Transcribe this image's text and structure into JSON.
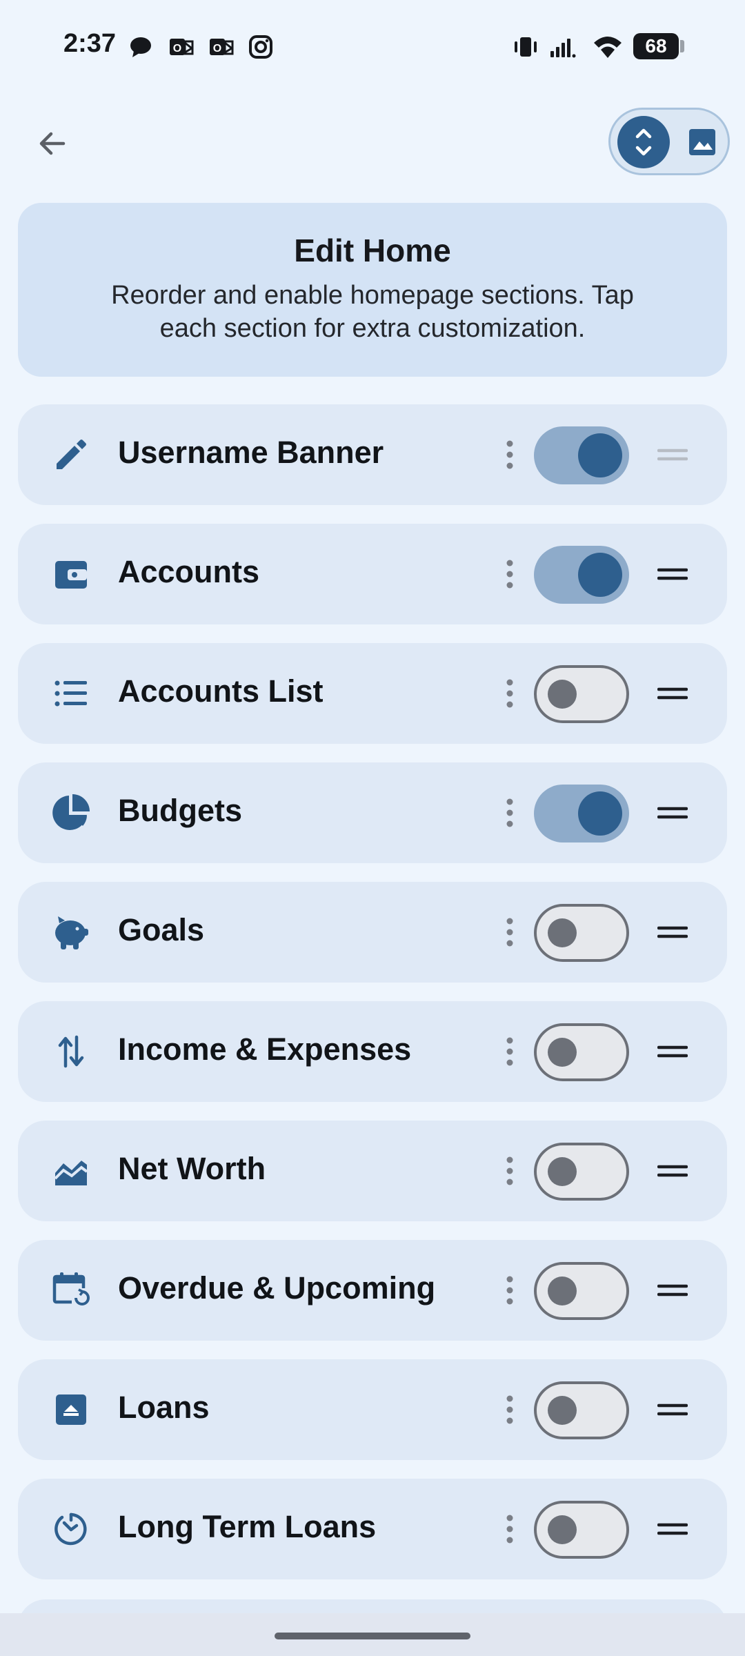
{
  "status_bar": {
    "time": "2:37",
    "battery": "68",
    "left_icons": [
      "chat-bubble-icon",
      "outlook-icon",
      "outlook-icon",
      "instagram-icon"
    ],
    "right_icons": [
      "vibrate-icon",
      "signal-icon",
      "wifi-icon",
      "battery-icon"
    ]
  },
  "top_bar": {
    "back_icon": "arrow-back-icon",
    "toggle": {
      "reorder_icon": "unfold-icon",
      "image_icon": "image-icon",
      "selected": "reorder"
    }
  },
  "header": {
    "title": "Edit Home",
    "description": "Reorder and enable homepage sections. Tap each section for extra customization."
  },
  "sections": [
    {
      "label": "Username Banner",
      "icon": "pencil-icon",
      "enabled": true
    },
    {
      "label": "Accounts",
      "icon": "wallet-icon",
      "enabled": true
    },
    {
      "label": "Accounts List",
      "icon": "list-icon",
      "enabled": false
    },
    {
      "label": "Budgets",
      "icon": "pie-chart-icon",
      "enabled": true
    },
    {
      "label": "Goals",
      "icon": "piggy-bank-icon",
      "enabled": false
    },
    {
      "label": "Income & Expenses",
      "icon": "swap-vertical-icon",
      "enabled": false
    },
    {
      "label": "Net Worth",
      "icon": "area-chart-icon",
      "enabled": false
    },
    {
      "label": "Overdue & Upcoming",
      "icon": "calendar-clock-icon",
      "enabled": false
    },
    {
      "label": "Loans",
      "icon": "archive-box-icon",
      "enabled": false
    },
    {
      "label": "Long Term Loans",
      "icon": "clock-icon",
      "enabled": false
    }
  ],
  "colors": {
    "background": "#eef5fd",
    "card": "#dfe9f6",
    "header_card": "#d4e3f5",
    "accent": "#2e5f8e",
    "switch_track_on": "#8eabca",
    "switch_off_outline": "#6c7078"
  }
}
